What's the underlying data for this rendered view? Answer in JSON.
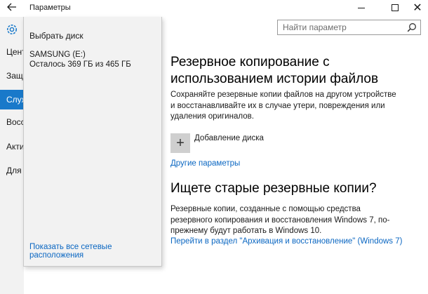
{
  "window": {
    "title": "Параметры",
    "back_icon": "back-arrow-icon",
    "close_glyph": "✕"
  },
  "nav": {
    "items": [
      {
        "label": "Центр",
        "selected": false
      },
      {
        "label": "Защита",
        "selected": false
      },
      {
        "label": "Служба",
        "selected": true
      },
      {
        "label": "Восстановление",
        "selected": false
      },
      {
        "label": "Активация",
        "selected": false
      },
      {
        "label": "Для разработчиков",
        "selected": false
      }
    ]
  },
  "search": {
    "placeholder": "Найти параметр",
    "icon": "search-icon"
  },
  "main": {
    "heading": "Резервное копирование с использованием истории файлов",
    "description": "Сохраняйте резервные копии файлов на другом устройстве и восстанавливайте их в случае утери, повреждения или удаления оригиналов.",
    "add_drive": {
      "icon_glyph": "+",
      "label": "Добавление диска"
    },
    "more_options_link": "Другие параметры",
    "old_backups_heading": "Ищете старые резервные копии?",
    "old_backups_text": "Резервные копии, созданные с помощью средства резервного копирования и восстановления Windows 7, по-прежнему будут работать в Windows 10.",
    "archive_link": "Перейти в раздел \"Архивация и восстановление\" (Windows 7)"
  },
  "flyout": {
    "title": "Выбрать диск",
    "drive_name": "SAMSUNG (E:)",
    "drive_free": "Осталось 369 ГБ из 465 ГБ",
    "network_link": "Показать все сетевые расположения"
  },
  "colors": {
    "accent": "#1979ca",
    "link": "#0b67c2",
    "flyout_bg": "#f2f2f2",
    "nav_bg": "#f2f2f2"
  }
}
